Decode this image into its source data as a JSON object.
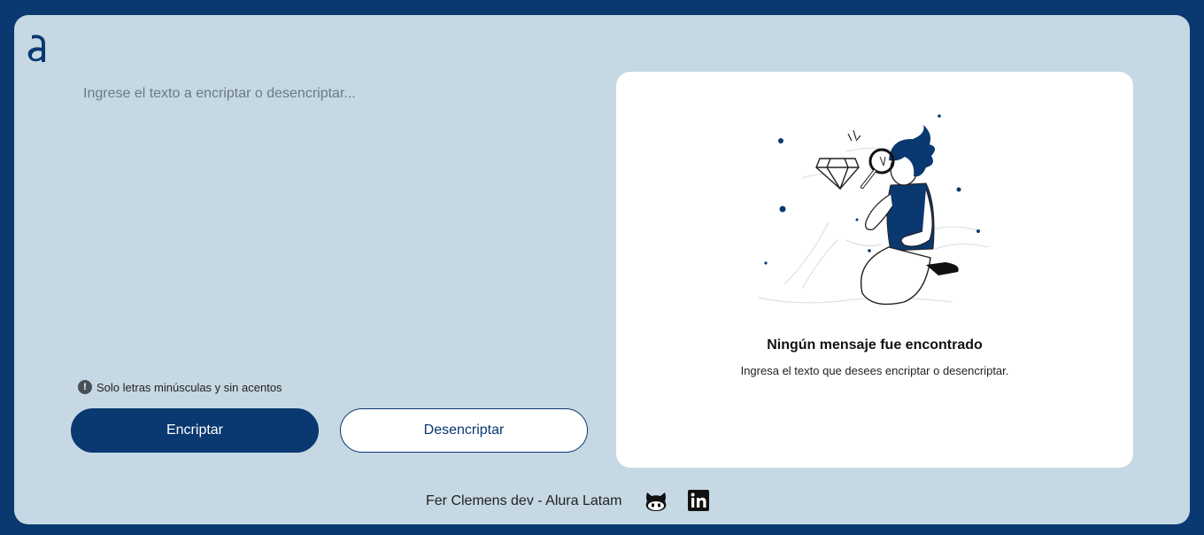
{
  "logo": {
    "icon": "alura-a-logo-icon",
    "color": "#0a3871"
  },
  "input": {
    "placeholder": "Ingrese el texto a encriptar o desencriptar...",
    "value": ""
  },
  "hint": {
    "icon": "exclamation-circle-icon",
    "text": "Solo letras minúsculas y sin acentos"
  },
  "buttons": {
    "encrypt_label": "Encriptar",
    "decrypt_label": "Desencriptar"
  },
  "output": {
    "illustration": "person-with-magnifying-glass-and-diamond",
    "title": "Ningún mensaje fue encontrado",
    "subtitle": "Ingresa el texto que desees encriptar o desencriptar."
  },
  "footer": {
    "credit": "Fer Clemens dev - Alura Latam",
    "github_icon": "github-icon",
    "linkedin_icon": "linkedin-icon"
  },
  "colors": {
    "accent": "#0a3871",
    "background": "#c5d8e3",
    "panel": "#ffffff"
  }
}
